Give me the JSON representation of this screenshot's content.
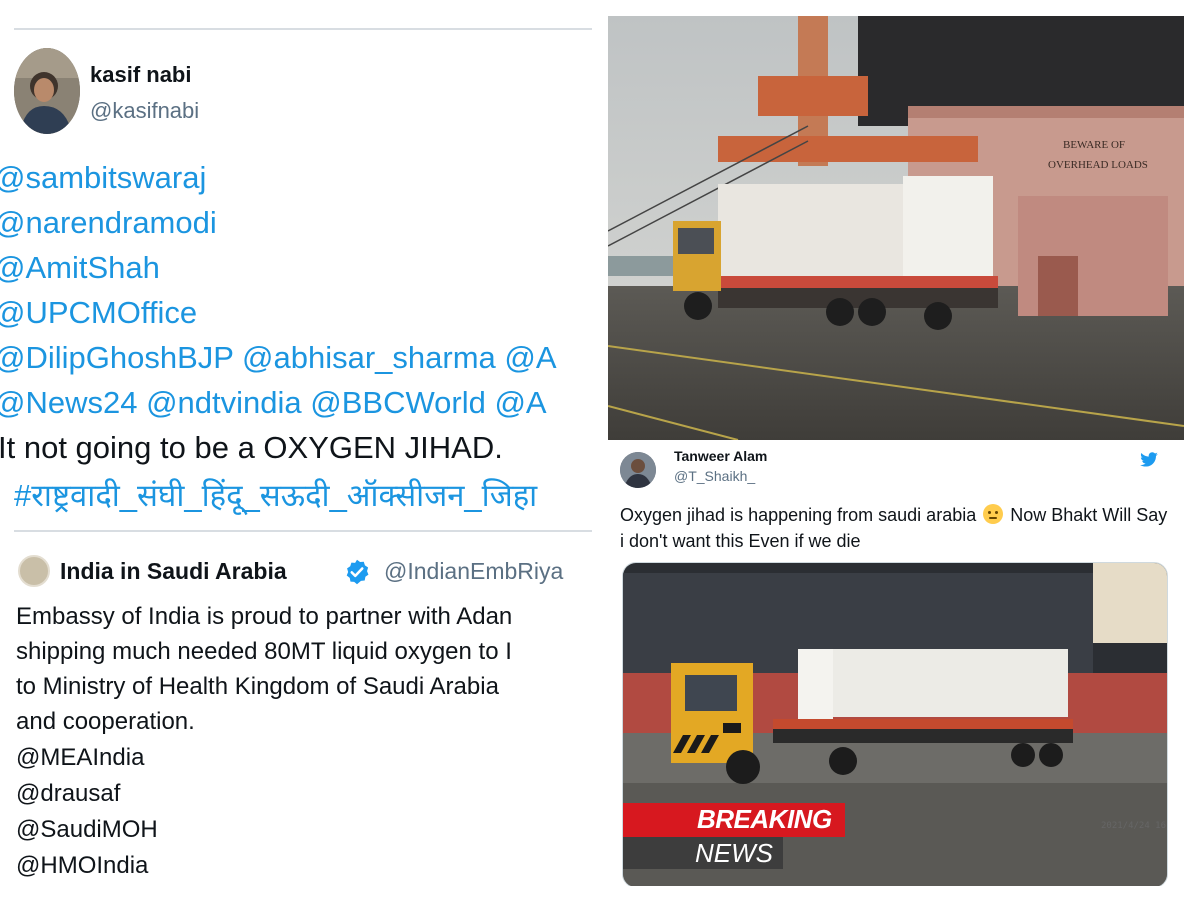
{
  "left_tweet": {
    "author_name": "kasif nabi",
    "author_handle": "@kasifnabi",
    "mention_lines": [
      "@sambitswaraj",
      "@narendramodi",
      "@AmitShah",
      "@UPCMOffice",
      "@DilipGhoshBJP @abhisar_sharma @A",
      "@News24 @ndtvindia @BBCWorld @A"
    ],
    "text_line": "It not going to be a OXYGEN JIHAD.",
    "hashtag_line": "#राष्ट्रवादी_संघी_हिंदू_सऊदी_ऑक्सीजन_जिहा"
  },
  "quoted_tweet": {
    "author_name": "India in Saudi Arabia",
    "author_handle": "@IndianEmbRiya",
    "body_lines": [
      "Embassy of India is proud to partner with Adan",
      "shipping much needed 80MT liquid oxygen to I",
      "to Ministry of Health Kingdom of Saudi Arabia",
      "and cooperation."
    ],
    "tags": [
      "@MEAIndia",
      "@drausaf",
      "@SaudiMOH",
      "@HMOIndia"
    ]
  },
  "photo": {
    "sign_line1": "BEWARE OF",
    "sign_line2": "OVERHEAD LOADS"
  },
  "right_tweet": {
    "author_name": "Tanweer Alam",
    "author_handle": "@T_Shaikh_",
    "text_before_emoji": "Oxygen jihad is happening from saudi arabia",
    "text_after_emoji": " Now Bhakt Will Say i don't want this Even if we die",
    "emoji": "frowning-face",
    "breaking_label": "BREAKING",
    "news_label": "NEWS",
    "timestamp": "2021/4/24 16"
  },
  "colors": {
    "link_blue": "#1b95e0",
    "breaking_red": "#d7181f",
    "news_grey": "#3d3d3d",
    "verified_blue": "#1d9bf0"
  }
}
